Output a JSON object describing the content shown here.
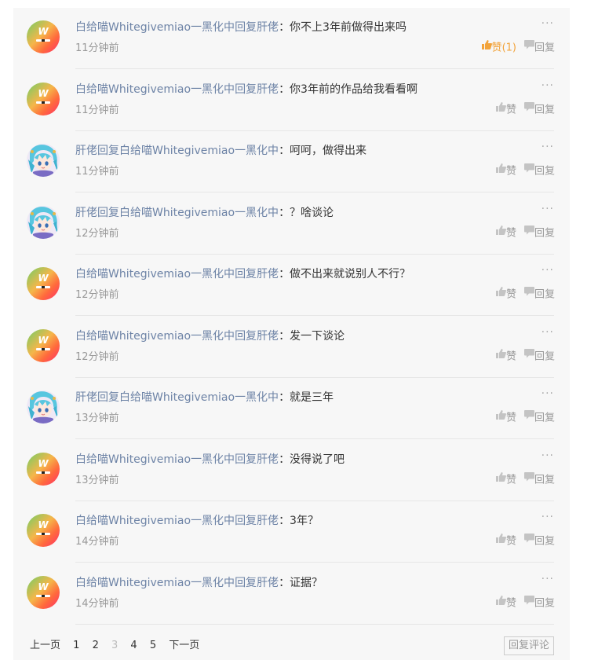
{
  "comments": [
    {
      "user": "白给喵Whitegivemiao一黑化中",
      "reply_word": "回复",
      "reply_to": "肝佬",
      "text": "：你不上3年前做得出来吗",
      "time": "11分钟前",
      "like_label": "赞",
      "like_count": "(1)",
      "liked": true,
      "reply_label": "回复",
      "avatar": "w"
    },
    {
      "user": "白给喵Whitegivemiao一黑化中",
      "reply_word": "回复",
      "reply_to": "肝佬",
      "text": "：你3年前的作品给我看看啊",
      "time": "11分钟前",
      "like_label": "赞",
      "like_count": "",
      "liked": false,
      "reply_label": "回复",
      "avatar": "w"
    },
    {
      "user": "肝佬",
      "reply_word": "回复",
      "reply_to": "白给喵Whitegivemiao一黑化中",
      "text": "：呵呵，做得出来",
      "time": "11分钟前",
      "like_label": "赞",
      "like_count": "",
      "liked": false,
      "reply_label": "回复",
      "avatar": "a"
    },
    {
      "user": "肝佬",
      "reply_word": "回复",
      "reply_to": "白给喵Whitegivemiao一黑化中",
      "text": "：？啥谈论",
      "time": "12分钟前",
      "like_label": "赞",
      "like_count": "",
      "liked": false,
      "reply_label": "回复",
      "avatar": "a"
    },
    {
      "user": "白给喵Whitegivemiao一黑化中",
      "reply_word": "回复",
      "reply_to": "肝佬",
      "text": "：做不出来就说别人不行？",
      "time": "12分钟前",
      "like_label": "赞",
      "like_count": "",
      "liked": false,
      "reply_label": "回复",
      "avatar": "w"
    },
    {
      "user": "白给喵Whitegivemiao一黑化中",
      "reply_word": "回复",
      "reply_to": "肝佬",
      "text": "：发一下谈论",
      "time": "12分钟前",
      "like_label": "赞",
      "like_count": "",
      "liked": false,
      "reply_label": "回复",
      "avatar": "w"
    },
    {
      "user": "肝佬",
      "reply_word": "回复",
      "reply_to": "白给喵Whitegivemiao一黑化中",
      "text": "：就是三年",
      "time": "13分钟前",
      "like_label": "赞",
      "like_count": "",
      "liked": false,
      "reply_label": "回复",
      "avatar": "a"
    },
    {
      "user": "白给喵Whitegivemiao一黑化中",
      "reply_word": "回复",
      "reply_to": "肝佬",
      "text": "：没得说了吧",
      "time": "13分钟前",
      "like_label": "赞",
      "like_count": "",
      "liked": false,
      "reply_label": "回复",
      "avatar": "w"
    },
    {
      "user": "白给喵Whitegivemiao一黑化中",
      "reply_word": "回复",
      "reply_to": "肝佬",
      "text": "：3年？",
      "time": "14分钟前",
      "like_label": "赞",
      "like_count": "",
      "liked": false,
      "reply_label": "回复",
      "avatar": "w"
    },
    {
      "user": "白给喵Whitegivemiao一黑化中",
      "reply_word": "回复",
      "reply_to": "肝佬",
      "text": "：证据？",
      "time": "14分钟前",
      "like_label": "赞",
      "like_count": "",
      "liked": false,
      "reply_label": "回复",
      "avatar": "w"
    }
  ],
  "more_label": "···",
  "pagination": {
    "prev": "上一页",
    "pages": [
      "1",
      "2",
      "3",
      "4",
      "5"
    ],
    "current_page": "3",
    "next": "下一页"
  },
  "reply_comment_button": "回复评论",
  "colors": {
    "username": "#6d83a6",
    "liked": "#f2a33a",
    "muted": "#999999",
    "panel_bg": "#f7f7f7"
  },
  "avatar_w_letter": "W",
  "icons": {
    "like": "thumbs-up-icon",
    "reply": "speech-bubble-icon",
    "more": "more-dots-icon"
  }
}
